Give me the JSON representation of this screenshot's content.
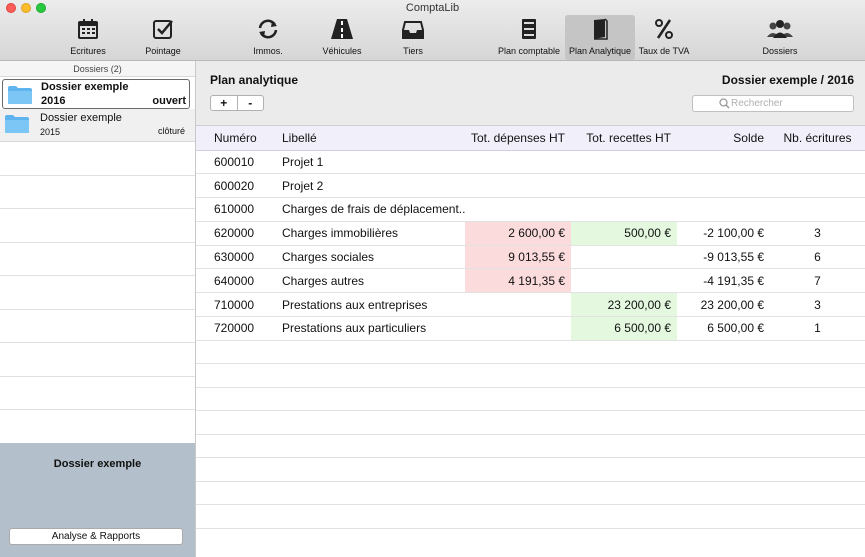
{
  "app": {
    "title": "ComptaLib"
  },
  "toolbar": [
    {
      "label": "Ecritures",
      "icon": "calendar-icon"
    },
    {
      "label": "Pointage",
      "icon": "checkbox-icon"
    },
    {
      "label": "Immos.",
      "icon": "refresh-icon"
    },
    {
      "label": "Véhicules",
      "icon": "road-icon"
    },
    {
      "label": "Tiers",
      "icon": "inbox-icon"
    },
    {
      "label": "Plan comptable",
      "icon": "cabinet-icon"
    },
    {
      "label": "Plan Analytique",
      "icon": "book-icon",
      "active": true
    },
    {
      "label": "Taux de TVA",
      "icon": "percent-icon"
    },
    {
      "label": "Dossiers",
      "icon": "people-icon"
    }
  ],
  "sidebar": {
    "header": "Dossiers (2)",
    "folders": [
      {
        "name": "Dossier exemple",
        "year": "2016",
        "status": "ouvert"
      },
      {
        "name": "Dossier exemple",
        "year": "2015",
        "status": "clôturé"
      }
    ],
    "bottom_title": "Dossier exemple",
    "bottom_button": "Analyse & Rapports"
  },
  "main": {
    "title": "Plan analytique",
    "dossier": "Dossier exemple / 2016",
    "plus": "+",
    "minus": "-",
    "search_placeholder": "Rechercher",
    "columns": [
      "Numéro",
      "Libellé",
      "Tot. dépenses HT",
      "Tot. recettes HT",
      "Solde",
      "Nb. écritures"
    ],
    "rows": [
      {
        "num": "600010",
        "lib": "Projet 1",
        "dep": "",
        "rec": "",
        "sol": "",
        "nb": ""
      },
      {
        "num": "600020",
        "lib": "Projet 2",
        "dep": "",
        "rec": "",
        "sol": "",
        "nb": ""
      },
      {
        "num": "610000",
        "lib": "Charges de frais de déplacement...",
        "dep": "",
        "rec": "",
        "sol": "",
        "nb": ""
      },
      {
        "num": "620000",
        "lib": "Charges immobilières",
        "dep": "2 600,00 €",
        "rec": "500,00 €",
        "sol": "-2 100,00 €",
        "nb": "3"
      },
      {
        "num": "630000",
        "lib": "Charges sociales",
        "dep": "9 013,55 €",
        "rec": "",
        "sol": "-9 013,55 €",
        "nb": "6"
      },
      {
        "num": "640000",
        "lib": "Charges autres",
        "dep": "4 191,35 €",
        "rec": "",
        "sol": "-4 191,35 €",
        "nb": "7"
      },
      {
        "num": "710000",
        "lib": "Prestations aux entreprises",
        "dep": "",
        "rec": "23 200,00 €",
        "sol": "23 200,00 €",
        "nb": "3"
      },
      {
        "num": "720000",
        "lib": "Prestations aux particuliers",
        "dep": "",
        "rec": "6 500,00 €",
        "sol": "6 500,00 €",
        "nb": "1"
      }
    ]
  },
  "colors": {
    "expense_bg": "#fbdbdc",
    "income_bg": "#e4f8df",
    "sidebar_bottom": "#b3bfcb",
    "header_bg": "#f1f0fa"
  }
}
